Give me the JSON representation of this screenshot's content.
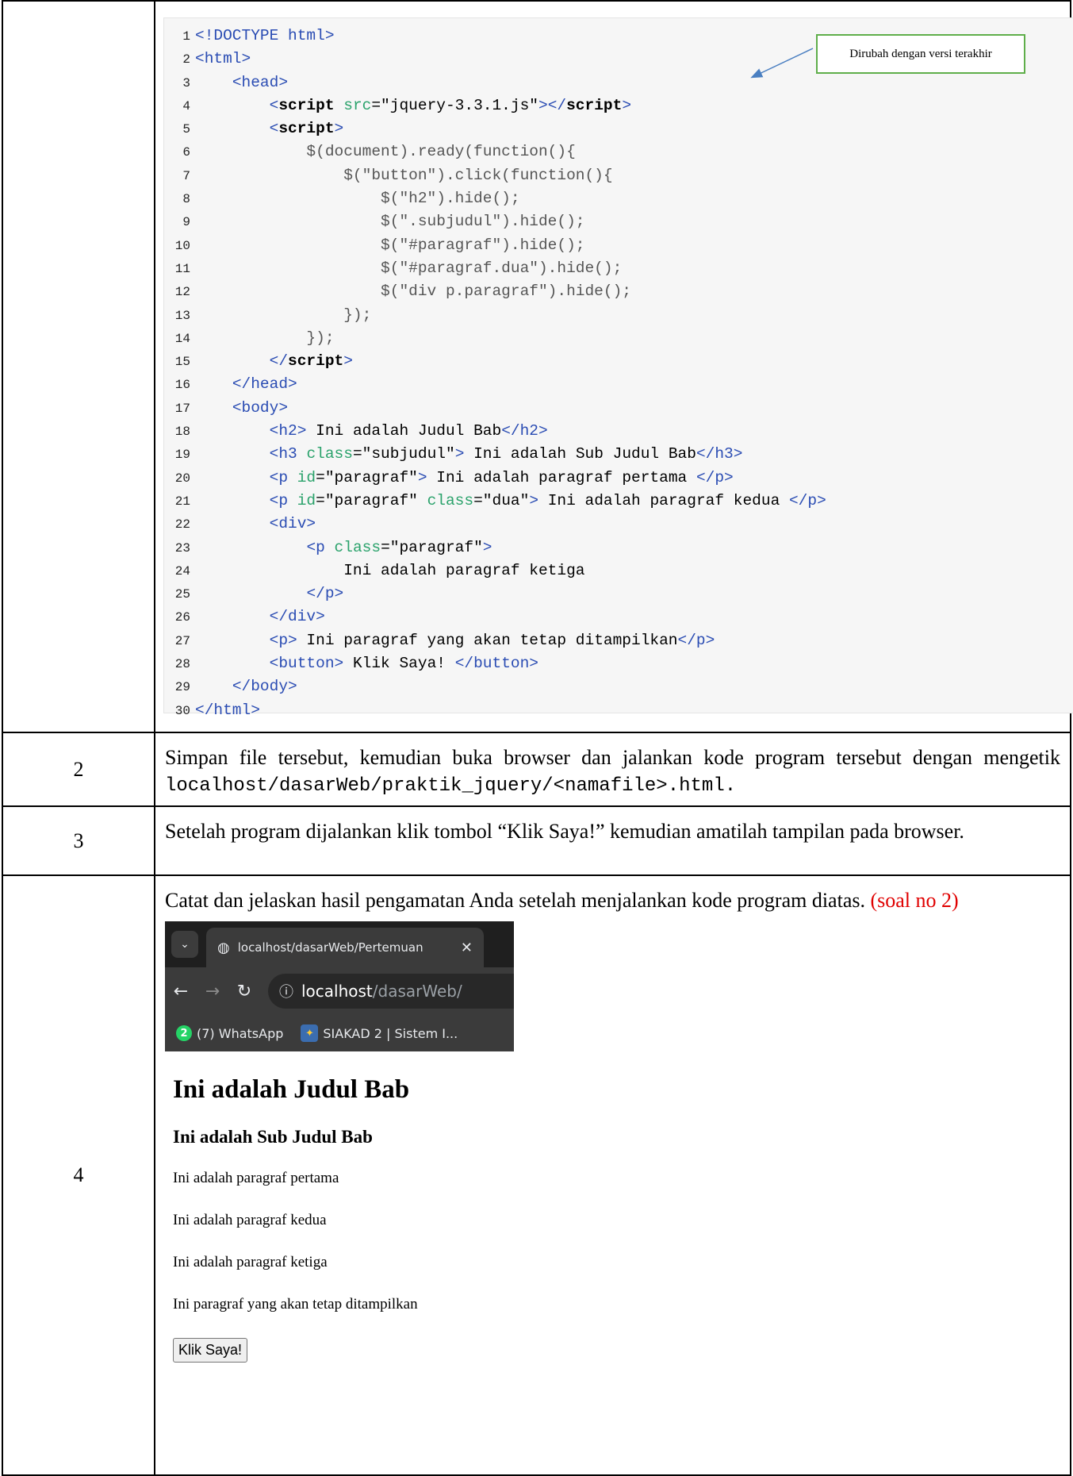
{
  "code": {
    "lines": [
      [
        {
          "t": "tag",
          "v": "<!DOCTYPE html>"
        }
      ],
      [
        {
          "t": "tag",
          "v": "<html>"
        }
      ],
      [
        {
          "t": "sp",
          "v": "    "
        },
        {
          "t": "tag",
          "v": "<head>"
        }
      ],
      [
        {
          "t": "sp",
          "v": "        "
        },
        {
          "t": "tag",
          "v": "<"
        },
        {
          "t": "kw",
          "v": "script"
        },
        {
          "t": "sp",
          "v": " "
        },
        {
          "t": "attr",
          "v": "src"
        },
        {
          "t": "plain",
          "v": "=\"jquery-3.3.1.js\""
        },
        {
          "t": "tag",
          "v": "></"
        },
        {
          "t": "kw",
          "v": "script"
        },
        {
          "t": "tag",
          "v": ">"
        }
      ],
      [
        {
          "t": "sp",
          "v": "        "
        },
        {
          "t": "tag",
          "v": "<"
        },
        {
          "t": "kw",
          "v": "script"
        },
        {
          "t": "tag",
          "v": ">"
        }
      ],
      [
        {
          "t": "js",
          "v": "            $(document).ready(function(){"
        }
      ],
      [
        {
          "t": "js",
          "v": "                $(\"button\").click(function(){"
        }
      ],
      [
        {
          "t": "js",
          "v": "                    $(\"h2\").hide();"
        }
      ],
      [
        {
          "t": "js",
          "v": "                    $(\".subjudul\").hide();"
        }
      ],
      [
        {
          "t": "js",
          "v": "                    $(\"#paragraf\").hide();"
        }
      ],
      [
        {
          "t": "js",
          "v": "                    $(\"#paragraf.dua\").hide();"
        }
      ],
      [
        {
          "t": "js",
          "v": "                    $(\"div p.paragraf\").hide();"
        }
      ],
      [
        {
          "t": "js",
          "v": "                });"
        }
      ],
      [
        {
          "t": "js",
          "v": "            });"
        }
      ],
      [
        {
          "t": "sp",
          "v": "        "
        },
        {
          "t": "tag",
          "v": "</"
        },
        {
          "t": "kw",
          "v": "script"
        },
        {
          "t": "tag",
          "v": ">"
        }
      ],
      [
        {
          "t": "sp",
          "v": "    "
        },
        {
          "t": "tag",
          "v": "</head>"
        }
      ],
      [
        {
          "t": "sp",
          "v": "    "
        },
        {
          "t": "tag",
          "v": "<body>"
        }
      ],
      [
        {
          "t": "sp",
          "v": "        "
        },
        {
          "t": "tag",
          "v": "<h2>"
        },
        {
          "t": "plain",
          "v": " Ini adalah Judul Bab"
        },
        {
          "t": "tag",
          "v": "</h2>"
        }
      ],
      [
        {
          "t": "sp",
          "v": "        "
        },
        {
          "t": "tag",
          "v": "<h3 "
        },
        {
          "t": "attr",
          "v": "class"
        },
        {
          "t": "plain",
          "v": "=\"subjudul\""
        },
        {
          "t": "tag",
          "v": ">"
        },
        {
          "t": "plain",
          "v": " Ini adalah Sub Judul Bab"
        },
        {
          "t": "tag",
          "v": "</h3>"
        }
      ],
      [
        {
          "t": "sp",
          "v": "        "
        },
        {
          "t": "tag",
          "v": "<p "
        },
        {
          "t": "attr",
          "v": "id"
        },
        {
          "t": "plain",
          "v": "=\"paragraf\""
        },
        {
          "t": "tag",
          "v": ">"
        },
        {
          "t": "plain",
          "v": " Ini adalah paragraf pertama "
        },
        {
          "t": "tag",
          "v": "</p>"
        }
      ],
      [
        {
          "t": "sp",
          "v": "        "
        },
        {
          "t": "tag",
          "v": "<p "
        },
        {
          "t": "attr",
          "v": "id"
        },
        {
          "t": "plain",
          "v": "=\"paragraf\" "
        },
        {
          "t": "attr",
          "v": "class"
        },
        {
          "t": "plain",
          "v": "=\"dua\""
        },
        {
          "t": "tag",
          "v": ">"
        },
        {
          "t": "plain",
          "v": " Ini adalah paragraf kedua "
        },
        {
          "t": "tag",
          "v": "</p>"
        }
      ],
      [
        {
          "t": "sp",
          "v": "        "
        },
        {
          "t": "tag",
          "v": "<div>"
        }
      ],
      [
        {
          "t": "sp",
          "v": "            "
        },
        {
          "t": "tag",
          "v": "<p "
        },
        {
          "t": "attr",
          "v": "class"
        },
        {
          "t": "plain",
          "v": "=\"paragraf\""
        },
        {
          "t": "tag",
          "v": ">"
        }
      ],
      [
        {
          "t": "plain",
          "v": "                Ini adalah paragraf ketiga"
        }
      ],
      [
        {
          "t": "sp",
          "v": "            "
        },
        {
          "t": "tag",
          "v": "</p>"
        }
      ],
      [
        {
          "t": "sp",
          "v": "        "
        },
        {
          "t": "tag",
          "v": "</div>"
        }
      ],
      [
        {
          "t": "sp",
          "v": "        "
        },
        {
          "t": "tag",
          "v": "<p>"
        },
        {
          "t": "plain",
          "v": " Ini paragraf yang akan tetap ditampilkan"
        },
        {
          "t": "tag",
          "v": "</p>"
        }
      ],
      [
        {
          "t": "sp",
          "v": "        "
        },
        {
          "t": "tag",
          "v": "<button>"
        },
        {
          "t": "plain",
          "v": " Klik Saya! "
        },
        {
          "t": "tag",
          "v": "</button>"
        }
      ],
      [
        {
          "t": "sp",
          "v": "    "
        },
        {
          "t": "tag",
          "v": "</body>"
        }
      ],
      [
        {
          "t": "tag",
          "v": "</html>"
        }
      ]
    ],
    "callout": "Dirubah dengan versi terakhir"
  },
  "steps": {
    "row2": {
      "num": "2",
      "text": "Simpan file tersebut, kemudian buka browser dan jalankan kode program tersebut dengan mengetik",
      "path": "localhost/dasarWeb/praktik_jquery/<namafile>.html."
    },
    "row3": {
      "num": "3",
      "text": "Setelah program dijalankan klik tombol “Klik Saya!” kemudian amatilah tampilan pada browser."
    },
    "row4": {
      "num": "4",
      "text": "Catat dan jelaskan hasil pengamatan Anda setelah menjalankan kode program diatas.",
      "note": "(soal no 2)"
    }
  },
  "browser": {
    "tab_title": "localhost/dasarWeb/Pertemuan",
    "url_host": "localhost",
    "url_path": "/dasarWeb/",
    "bookmarks": [
      {
        "badge": "2",
        "label": "(7) WhatsApp"
      },
      {
        "label": "SIAKAD 2 | Sistem I..."
      }
    ]
  },
  "rendered_page": {
    "h2": "Ini adalah Judul Bab",
    "h3": "Ini adalah Sub Judul Bab",
    "p1": "Ini adalah paragraf pertama",
    "p2": "Ini adalah paragraf kedua",
    "p3": "Ini adalah paragraf ketiga",
    "p4": "Ini paragraf yang akan tetap ditampilkan",
    "button": "Klik Saya!"
  }
}
